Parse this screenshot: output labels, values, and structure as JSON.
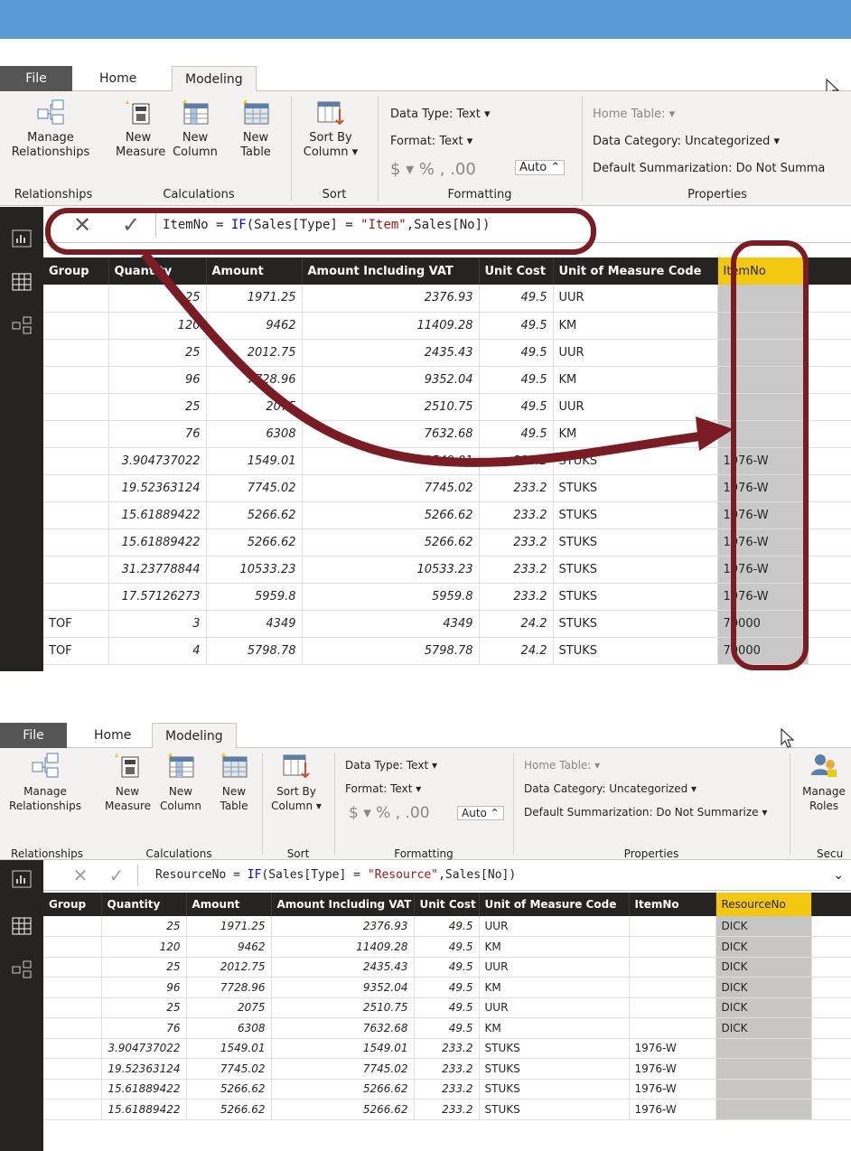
{
  "ribbon_tabs": [
    "File",
    "Home",
    "Modeling"
  ],
  "ribbon": {
    "manage_rel": [
      "Manage",
      "Relationships"
    ],
    "new_measure": [
      "New",
      "Measure"
    ],
    "new_column": [
      "New",
      "Column"
    ],
    "new_table": [
      "New",
      "Table"
    ],
    "sort_by": [
      "Sort By",
      "Column ▾"
    ],
    "data_type": "Data Type: Text ▾",
    "format": "Format: Text ▾",
    "currency": "$ ▾ %  ,  .00",
    "auto": "Auto  ⌃",
    "home_table": "Home Table:  ▾",
    "data_category": "Data Category: Uncategorized ▾",
    "default_summ_1": "Default Summarization: Do Not Summa",
    "default_summ_2": "Default Summarization: Do Not Summarize ▾",
    "manage_roles": [
      "Manage",
      "Roles"
    ],
    "groups": {
      "relationships": "Relationships",
      "calculations": "Calculations",
      "sort": "Sort",
      "formatting": "Formatting",
      "properties": "Properties",
      "security": "Secu"
    }
  },
  "screen1": {
    "formula": {
      "lhs": "ItemNo = ",
      "fn": "IF",
      "open": "(Sales[Type] = ",
      "str": "\"Item\"",
      "rest": ",Sales[No])"
    },
    "headers": [
      "Group",
      "Quantity",
      "Amount",
      "Amount Including VAT",
      "Unit Cost",
      "Unit of Measure Code",
      "ItemNo"
    ],
    "rows": [
      [
        "",
        "25",
        "1971.25",
        "2376.93",
        "49.5",
        "UUR",
        ""
      ],
      [
        "",
        "120",
        "9462",
        "11409.28",
        "49.5",
        "KM",
        ""
      ],
      [
        "",
        "25",
        "2012.75",
        "2435.43",
        "49.5",
        "UUR",
        ""
      ],
      [
        "",
        "96",
        "7728.96",
        "9352.04",
        "49.5",
        "KM",
        ""
      ],
      [
        "",
        "25",
        "2075",
        "2510.75",
        "49.5",
        "UUR",
        ""
      ],
      [
        "",
        "76",
        "6308",
        "7632.68",
        "49.5",
        "KM",
        ""
      ],
      [
        "",
        "3.904737022",
        "1549.01",
        "1549.01",
        "233.2",
        "STUKS",
        "1976-W"
      ],
      [
        "",
        "19.52363124",
        "7745.02",
        "7745.02",
        "233.2",
        "STUKS",
        "1976-W"
      ],
      [
        "",
        "15.61889422",
        "5266.62",
        "5266.62",
        "233.2",
        "STUKS",
        "1976-W"
      ],
      [
        "",
        "15.61889422",
        "5266.62",
        "5266.62",
        "233.2",
        "STUKS",
        "1976-W"
      ],
      [
        "",
        "31.23778844",
        "10533.23",
        "10533.23",
        "233.2",
        "STUKS",
        "1976-W"
      ],
      [
        "",
        "17.57126273",
        "5959.8",
        "5959.8",
        "233.2",
        "STUKS",
        "1976-W"
      ],
      [
        "TOF",
        "3",
        "4349",
        "4349",
        "24.2",
        "STUKS",
        "70000"
      ],
      [
        "TOF",
        "4",
        "5798.78",
        "5798.78",
        "24.2",
        "STUKS",
        "70000"
      ]
    ]
  },
  "screen2": {
    "formula": {
      "lhs": "ResourceNo = ",
      "fn": "IF",
      "open": "(Sales[Type] = ",
      "str": "\"Resource\"",
      "rest": ",Sales[No])"
    },
    "headers": [
      "Group",
      "Quantity",
      "Amount",
      "Amount Including VAT",
      "Unit Cost",
      "Unit of Measure Code",
      "ItemNo",
      "ResourceNo"
    ],
    "rows": [
      [
        "",
        "25",
        "1971.25",
        "2376.93",
        "49.5",
        "UUR",
        "",
        "DICK"
      ],
      [
        "",
        "120",
        "9462",
        "11409.28",
        "49.5",
        "KM",
        "",
        "DICK"
      ],
      [
        "",
        "25",
        "2012.75",
        "2435.43",
        "49.5",
        "UUR",
        "",
        "DICK"
      ],
      [
        "",
        "96",
        "7728.96",
        "9352.04",
        "49.5",
        "KM",
        "",
        "DICK"
      ],
      [
        "",
        "25",
        "2075",
        "2510.75",
        "49.5",
        "UUR",
        "",
        "DICK"
      ],
      [
        "",
        "76",
        "6308",
        "7632.68",
        "49.5",
        "KM",
        "",
        "DICK"
      ],
      [
        "",
        "3.904737022",
        "1549.01",
        "1549.01",
        "233.2",
        "STUKS",
        "1976-W",
        ""
      ],
      [
        "",
        "19.52363124",
        "7745.02",
        "7745.02",
        "233.2",
        "STUKS",
        "1976-W",
        ""
      ],
      [
        "",
        "15.61889422",
        "5266.62",
        "5266.62",
        "233.2",
        "STUKS",
        "1976-W",
        ""
      ],
      [
        "",
        "15.61889422",
        "5266.62",
        "5266.62",
        "233.2",
        "STUKS",
        "1976-W",
        ""
      ]
    ]
  },
  "colors": {
    "accent": "#f2c811",
    "annotation": "#7b1c24",
    "banner": "#5b9bd5"
  }
}
